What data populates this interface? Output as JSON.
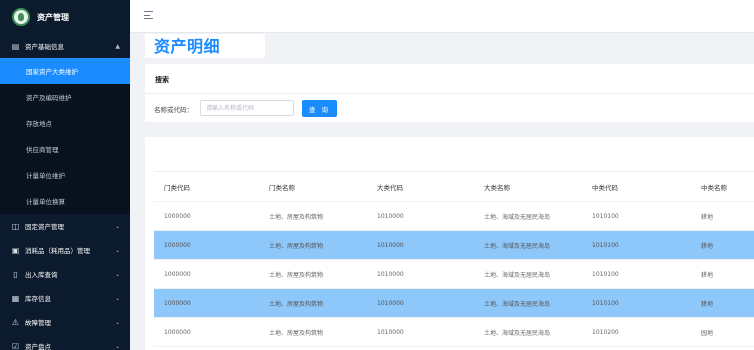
{
  "app": {
    "title": "资产管理"
  },
  "sidebar": {
    "groups": [
      {
        "label": "资产基础信息",
        "icon": "book-icon",
        "expanded": true
      },
      {
        "label": "固定资产管理",
        "icon": "cube-icon"
      },
      {
        "label": "消耗品（耗用品）管理",
        "icon": "box-icon"
      },
      {
        "label": "出入库查询",
        "icon": "doc-icon"
      },
      {
        "label": "库存信息",
        "icon": "grid-icon"
      },
      {
        "label": "故障管理",
        "icon": "warning-icon"
      },
      {
        "label": "资产盘点",
        "icon": "check-icon"
      }
    ],
    "items": [
      {
        "label": "国家资产大类维护",
        "active": true
      },
      {
        "label": "资产及编码维护"
      },
      {
        "label": "存放地点"
      },
      {
        "label": "供应商管理"
      },
      {
        "label": "计量单位维护"
      },
      {
        "label": "计量单位换算"
      }
    ]
  },
  "page": {
    "title": "资产明细"
  },
  "search": {
    "title": "搜索",
    "field_label": "名称或代码：",
    "placeholder": "请输入名称或代码",
    "button_label": "查 询"
  },
  "table": {
    "columns": [
      "门类代码",
      "门类名称",
      "大类代码",
      "大类名称",
      "中类代码",
      "中类名称"
    ],
    "rows": [
      [
        "1000000",
        "土地、房屋及构筑物",
        "1010000",
        "土地、海域及无居民海岛",
        "1010100",
        "耕地"
      ],
      [
        "1000000",
        "土地、房屋及构筑物",
        "1010000",
        "土地、海域及无居民海岛",
        "1010100",
        "耕地"
      ],
      [
        "1000000",
        "土地、房屋及构筑物",
        "1010000",
        "土地、海域及无居民海岛",
        "1010100",
        "耕地"
      ],
      [
        "1000000",
        "土地、房屋及构筑物",
        "1010000",
        "土地、海域及无居民海岛",
        "1010100",
        "耕地"
      ],
      [
        "1000000",
        "土地、房屋及构筑物",
        "1010000",
        "土地、海域及无居民海岛",
        "1010200",
        "园地"
      ]
    ],
    "highlighted_rows": [
      1,
      3
    ]
  },
  "colors": {
    "sidebar_bg": "#0b1a2c",
    "accent": "#1a8cff",
    "row_highlight": "#8ec7fa"
  }
}
